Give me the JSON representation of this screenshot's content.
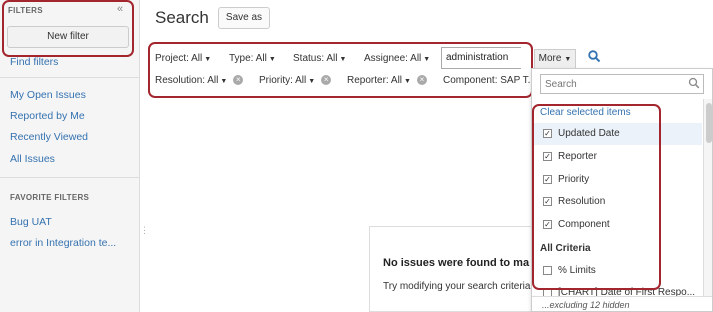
{
  "sidebar": {
    "filters_heading": "FILTERS",
    "new_filter_label": "New filter",
    "find_filters_label": "Find filters",
    "links": [
      {
        "label": "My Open Issues"
      },
      {
        "label": "Reported by Me"
      },
      {
        "label": "Recently Viewed"
      },
      {
        "label": "All Issues"
      }
    ],
    "favorite_heading": "FAVORITE FILTERS",
    "favorites": [
      {
        "label": "Bug UAT"
      },
      {
        "label": "error in Integration te..."
      }
    ]
  },
  "header": {
    "title": "Search",
    "save_as_label": "Save as"
  },
  "criteria": {
    "project": "Project: All",
    "type": "Type: All",
    "status": "Status: All",
    "assignee": "Assignee: All",
    "text_value": "administration",
    "more_label": "More",
    "resolution": "Resolution: All",
    "priority": "Priority: All",
    "reporter": "Reporter: All",
    "component": "Component: SAP T..."
  },
  "results": {
    "title": "No issues were found to ma",
    "message": "Try modifying your search criteria"
  },
  "more_dropdown": {
    "search_placeholder": "Search",
    "clear_selected_label": "Clear selected items",
    "selected_items": [
      {
        "label": "Updated Date",
        "checked": true
      },
      {
        "label": "Reporter",
        "checked": true
      },
      {
        "label": "Priority",
        "checked": true
      },
      {
        "label": "Resolution",
        "checked": true
      },
      {
        "label": "Component",
        "checked": true
      }
    ],
    "all_criteria_heading": "All Criteria",
    "all_criteria_items": [
      {
        "label": "% Limits",
        "checked": false
      },
      {
        "label": "[CHART] Date of First Respo...",
        "checked": false
      }
    ],
    "footer_text": "...excluding 12 hidden"
  },
  "colors": {
    "link": "#3572b0",
    "highlight": "#a3262e"
  }
}
